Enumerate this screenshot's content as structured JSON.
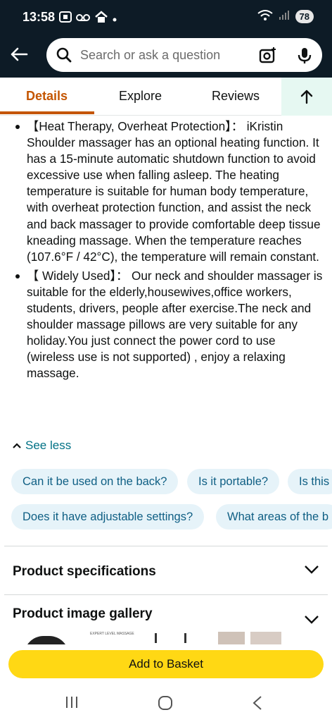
{
  "status_bar": {
    "time": "13:58",
    "battery": "78",
    "icons": [
      "screenshot-icon",
      "voicemail-icon",
      "home-icon",
      "dot-icon",
      "wifi-icon",
      "signal-icon"
    ]
  },
  "search": {
    "placeholder": "Search or ask a question"
  },
  "tabs": [
    {
      "label": "Details",
      "active": true
    },
    {
      "label": "Explore",
      "active": false
    },
    {
      "label": "Reviews",
      "active": false
    }
  ],
  "bullets": [
    "【Heat Therapy, Overheat Protection】： iKristin Shoulder massager has an optional heating function. It has a 15-minute automatic shutdown function to avoid excessive use when falling asleep. The heating temperature is suitable for human body temperature, with overheat protection function, and assist the neck and back massager to provide comfortable deep tissue kneading massage. When the temperature reaches (107.6°F / 42°C), the temperature will remain constant.",
    "【 Widely Used】： Our neck and shoulder massager is suitable for the elderly,housewives,office workers, students, drivers, people after exercise.The neck and shoulder massage pillows are very suitable for any holiday.You just connect the power cord to use (wireless use is not supported) , enjoy a relaxing massage."
  ],
  "see_less": "See less",
  "question_chips_row1": [
    "Can it be used on the back?",
    "Is it portable?",
    "Is this"
  ],
  "question_chips_row2": [
    "Does it have adjustable settings?",
    "What areas of the b"
  ],
  "sections": {
    "specs": "Product specifications",
    "gallery": "Product image gallery"
  },
  "gallery_thumb_text": "EXPERT LEVEL MASSAGE",
  "add_to_basket": "Add to Basket",
  "colors": {
    "header_bg": "#0d1b26",
    "accent_orange": "#c45500",
    "link_teal": "#007185",
    "chip_bg": "#e6f3f9",
    "button_yellow": "#ffd814"
  }
}
